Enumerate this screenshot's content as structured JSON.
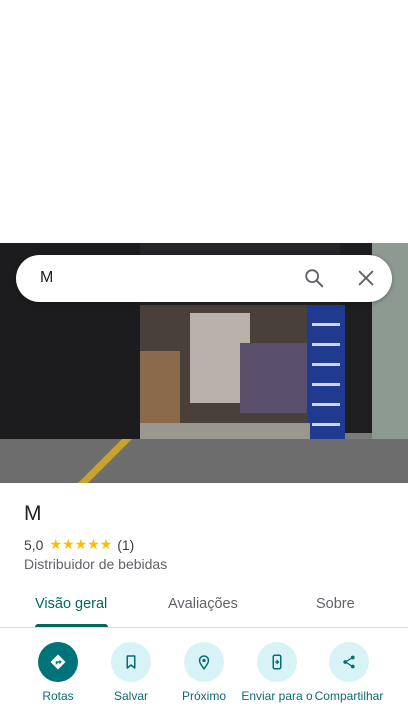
{
  "search": {
    "value": "M",
    "search_icon": "search-icon",
    "close_icon": "close-icon"
  },
  "place": {
    "name": "M",
    "rating": "5,0",
    "stars": "★★★★★",
    "review_count": "(1)",
    "category": "Distribuidor de bebidas"
  },
  "tabs": [
    {
      "label": "Visão geral",
      "active": true
    },
    {
      "label": "Avaliações",
      "active": false
    },
    {
      "label": "Sobre",
      "active": false
    }
  ],
  "actions": [
    {
      "label": "Rotas",
      "icon": "directions-icon"
    },
    {
      "label": "Salvar",
      "icon": "bookmark-icon"
    },
    {
      "label": "Próximo",
      "icon": "nearby-icon"
    },
    {
      "label": "Enviar para o",
      "icon": "send-to-phone-icon"
    },
    {
      "label": "Compartilhar",
      "icon": "share-icon"
    }
  ],
  "colors": {
    "accent": "#00695c",
    "chip_bg": "#d8f3f5",
    "primary_action": "#00737a",
    "star": "#fbbc04"
  }
}
